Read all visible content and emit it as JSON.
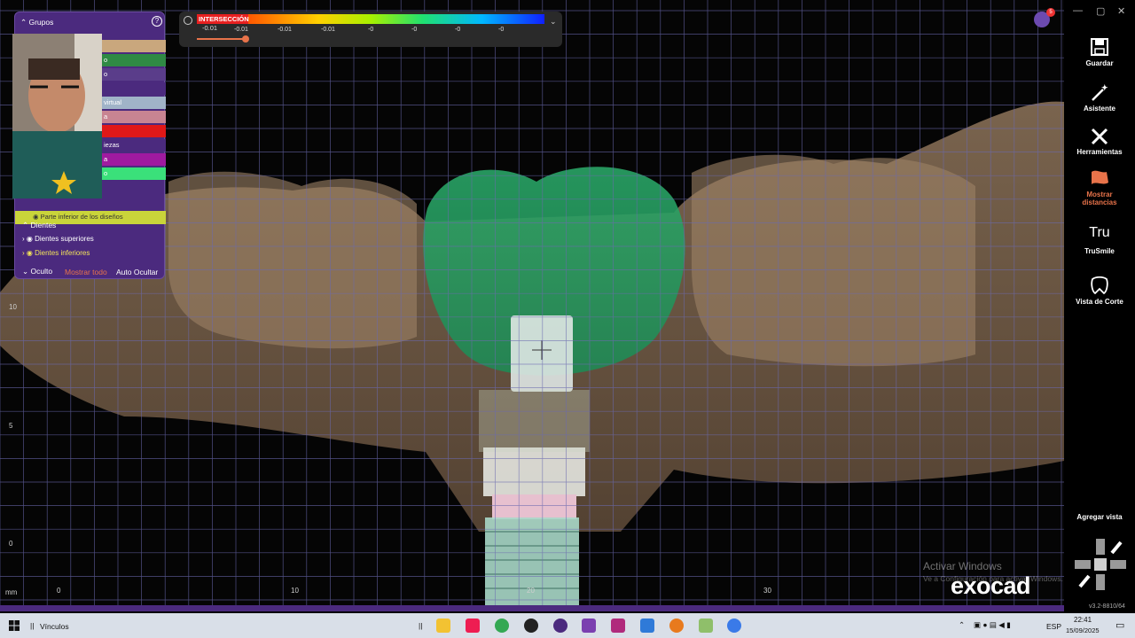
{
  "app": {
    "brand": "exocad",
    "version": "v3.2-8810/64"
  },
  "panel": {
    "title": "Grupos",
    "rows": [
      {
        "label": "",
        "color": "#c9a77d"
      },
      {
        "label": "o",
        "color": "#2f8a44"
      },
      {
        "label": "o",
        "color": "#5a3d8a"
      },
      {
        "label": "",
        "color": "#4b2a7e"
      },
      {
        "label": "virtual",
        "color": "#a0b3c8"
      },
      {
        "label": "a",
        "color": "#c88492"
      },
      {
        "label": "",
        "color": "#e01818"
      },
      {
        "label": "iezas",
        "color": "#4b2a7e"
      },
      {
        "label": "a",
        "color": "#a01aa0"
      },
      {
        "label": "o",
        "color": "#3ae07a"
      }
    ],
    "highlight_row": "Parte inferior de los diseños",
    "section_teeth": "Dientes",
    "upper_teeth": "Dientes superiores",
    "lower_teeth": "Dientes inferiores",
    "hidden_label": "Oculto",
    "show_all": "Mostrar todo",
    "auto_hide": "Auto Ocultar"
  },
  "intersection": {
    "label": "INTERSECCIÓN",
    "slider_value": "-0.01",
    "ticks": [
      "-0.01",
      "-0.01",
      "-0.01",
      "-0",
      "-0",
      "-0",
      "-0"
    ]
  },
  "notifications": {
    "count": "5"
  },
  "toolbar": {
    "save": "Guardar",
    "wizard": "Asistente",
    "tools": "Herramientas",
    "show_distances": "Mostrar distancias",
    "trusmile_icon_text": "Tru",
    "trusmile": "TruSmile",
    "section_view": "Vista de Corte",
    "add_view": "Agregar vista"
  },
  "ruler": {
    "unit": "mm",
    "vertical": [
      "10",
      "5",
      "0"
    ],
    "horizontal": [
      "0",
      "10",
      "20",
      "30"
    ]
  },
  "watermark": {
    "line1": "Activar Windows",
    "line2": "Ve a Configuración para activar Windows."
  },
  "taskbar": {
    "links": "Vínculos",
    "language": "ESP",
    "time": "22:41",
    "date": "15/09/2025"
  }
}
